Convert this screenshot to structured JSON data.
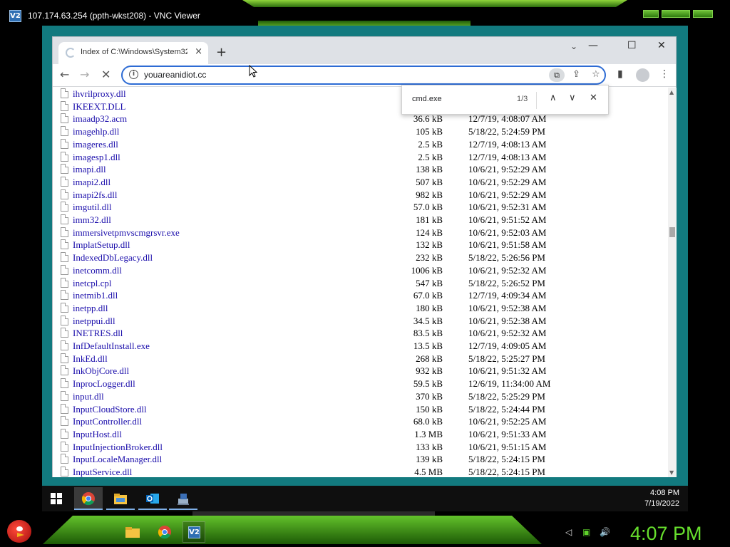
{
  "vnc": {
    "title": "107.174.63.254 (ppth-wkst208) - VNC Viewer",
    "icon": "vnc-icon",
    "logo_text": "V2"
  },
  "browser": {
    "tab_title": "Index of C:\\Windows\\System32\\",
    "tab_close": "×",
    "new_tab": "+",
    "tab_search": "⌄",
    "minimize": "—",
    "maximize": "☐",
    "close": "✕",
    "back": "←",
    "forward": "→",
    "stop": "✕",
    "url": "youareanidiot.cc",
    "info_glyph": "i",
    "find_glyph": "⧉",
    "share_glyph": "⇪",
    "star_glyph": "☆",
    "sidepanel_glyph": "▮",
    "menu_glyph": "⋮"
  },
  "find_bar": {
    "query": "cmd.exe",
    "count": "1/3",
    "prev": "∧",
    "next": "∨",
    "close": "✕"
  },
  "files": [
    {
      "name": "ihvrilproxy.dll",
      "size": "",
      "date": ""
    },
    {
      "name": "IKEEXT.DLL",
      "size": "",
      "date": ""
    },
    {
      "name": "imaadp32.acm",
      "size": "36.6 kB",
      "date": "12/7/19, 4:08:07 AM"
    },
    {
      "name": "imagehlp.dll",
      "size": "105 kB",
      "date": "5/18/22, 5:24:59 PM"
    },
    {
      "name": "imageres.dll",
      "size": "2.5 kB",
      "date": "12/7/19, 4:08:13 AM"
    },
    {
      "name": "imagesp1.dll",
      "size": "2.5 kB",
      "date": "12/7/19, 4:08:13 AM"
    },
    {
      "name": "imapi.dll",
      "size": "138 kB",
      "date": "10/6/21, 9:52:29 AM"
    },
    {
      "name": "imapi2.dll",
      "size": "507 kB",
      "date": "10/6/21, 9:52:29 AM"
    },
    {
      "name": "imapi2fs.dll",
      "size": "982 kB",
      "date": "10/6/21, 9:52:29 AM"
    },
    {
      "name": "imgutil.dll",
      "size": "57.0 kB",
      "date": "10/6/21, 9:52:31 AM"
    },
    {
      "name": "imm32.dll",
      "size": "181 kB",
      "date": "10/6/21, 9:51:52 AM"
    },
    {
      "name": "immersivetpmvscmgrsvr.exe",
      "size": "124 kB",
      "date": "10/6/21, 9:52:03 AM"
    },
    {
      "name": "ImplatSetup.dll",
      "size": "132 kB",
      "date": "10/6/21, 9:51:58 AM"
    },
    {
      "name": "IndexedDbLegacy.dll",
      "size": "232 kB",
      "date": "5/18/22, 5:26:56 PM"
    },
    {
      "name": "inetcomm.dll",
      "size": "1006 kB",
      "date": "10/6/21, 9:52:32 AM"
    },
    {
      "name": "inetcpl.cpl",
      "size": "547 kB",
      "date": "5/18/22, 5:26:52 PM"
    },
    {
      "name": "inetmib1.dll",
      "size": "67.0 kB",
      "date": "12/7/19, 4:09:34 AM"
    },
    {
      "name": "inetpp.dll",
      "size": "180 kB",
      "date": "10/6/21, 9:52:38 AM"
    },
    {
      "name": "inetppui.dll",
      "size": "34.5 kB",
      "date": "10/6/21, 9:52:38 AM"
    },
    {
      "name": "INETRES.dll",
      "size": "83.5 kB",
      "date": "10/6/21, 9:52:32 AM"
    },
    {
      "name": "InfDefaultInstall.exe",
      "size": "13.5 kB",
      "date": "12/7/19, 4:09:05 AM"
    },
    {
      "name": "InkEd.dll",
      "size": "268 kB",
      "date": "5/18/22, 5:25:27 PM"
    },
    {
      "name": "InkObjCore.dll",
      "size": "932 kB",
      "date": "10/6/21, 9:51:32 AM"
    },
    {
      "name": "InprocLogger.dll",
      "size": "59.5 kB",
      "date": "12/6/19, 11:34:00 AM"
    },
    {
      "name": "input.dll",
      "size": "370 kB",
      "date": "5/18/22, 5:25:29 PM"
    },
    {
      "name": "InputCloudStore.dll",
      "size": "150 kB",
      "date": "5/18/22, 5:24:44 PM"
    },
    {
      "name": "InputController.dll",
      "size": "68.0 kB",
      "date": "10/6/21, 9:52:25 AM"
    },
    {
      "name": "InputHost.dll",
      "size": "1.3 MB",
      "date": "10/6/21, 9:51:33 AM"
    },
    {
      "name": "InputInjectionBroker.dll",
      "size": "133 kB",
      "date": "10/6/21, 9:51:15 AM"
    },
    {
      "name": "InputLocaleManager.dll",
      "size": "139 kB",
      "date": "5/18/22, 5:24:15 PM"
    },
    {
      "name": "InputService.dll",
      "size": "4.5 MB",
      "date": "5/18/22, 5:24:15 PM"
    }
  ],
  "remote_taskbar": {
    "time": "4:08 PM",
    "date": "7/19/2022",
    "apps": [
      "chrome-icon",
      "file-explorer-icon",
      "outlook-icon",
      "network-app-icon"
    ]
  },
  "local_taskbar": {
    "time": "4:07 PM",
    "apps": [
      "folder-icon",
      "chrome-icon",
      "vnc-icon"
    ],
    "vnc_label": "V2",
    "tray_glyph_1": "◁",
    "tray_glyph_2": "▣",
    "tray_glyph_3": "🔊"
  },
  "colors": {
    "link": "#1a0dab",
    "accent_blue": "#2d6bd4",
    "teal_desktop": "#127a7f",
    "green_clock": "#67e02d"
  }
}
